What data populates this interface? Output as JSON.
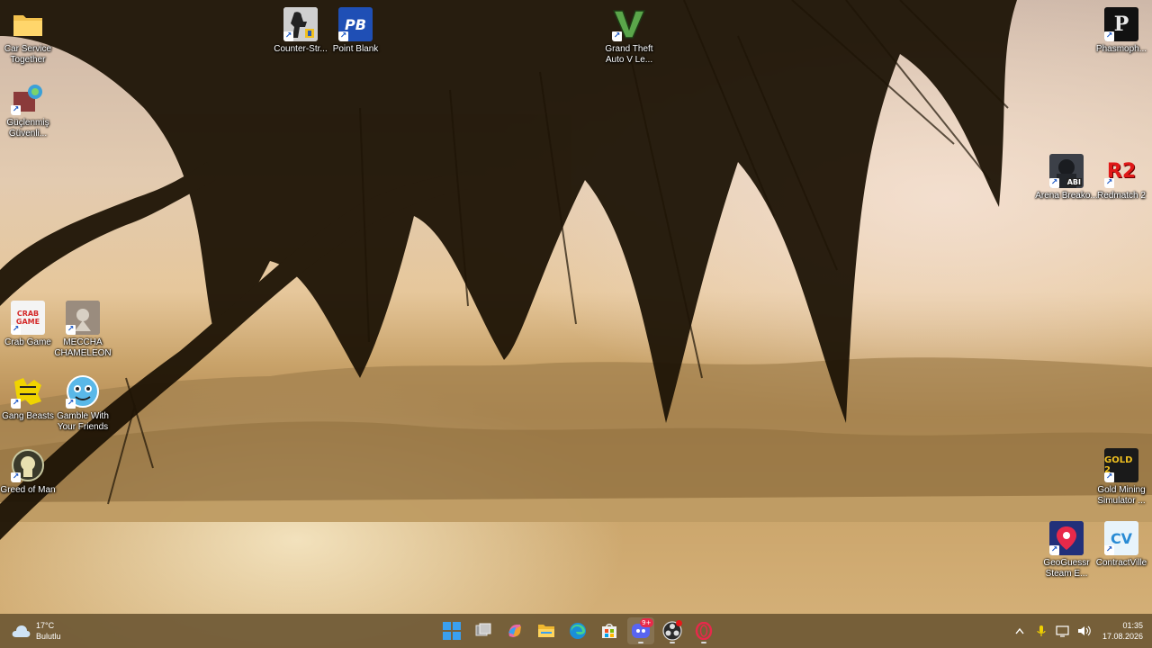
{
  "desktop": {
    "icons": [
      {
        "label": "Car Service Together",
        "icon": "folder-icon"
      },
      {
        "label": "Güçlenmiş Güvenli...",
        "icon": "secure-browser-icon"
      },
      {
        "label": "Counter-Str...",
        "icon": "counter-strike-icon"
      },
      {
        "label": "Point Blank",
        "icon": "point-blank-icon"
      },
      {
        "label": "Grand Theft Auto V Le...",
        "icon": "gta-v-icon"
      },
      {
        "label": "Phasmoph...",
        "icon": "phasmophobia-icon"
      },
      {
        "label": "Arena Breako...",
        "icon": "arena-breakout-icon",
        "badge": "ABI"
      },
      {
        "label": "Redmatch 2",
        "icon": "redmatch-2-icon",
        "badge": "R2"
      },
      {
        "label": "Crab Game",
        "icon": "crab-game-icon",
        "badge": "CRAB GAME"
      },
      {
        "label": "MECCHA CHAMELEON",
        "icon": "meccha-chameleon-icon"
      },
      {
        "label": "Gang Beasts",
        "icon": "gang-beasts-icon"
      },
      {
        "label": "Gamble With Your Friends",
        "icon": "gamble-with-your-friends-icon"
      },
      {
        "label": "Greed of Man",
        "icon": "greed-of-man-icon"
      },
      {
        "label": "Gold Mining Simulator ...",
        "icon": "gold-mining-simulator-icon",
        "badge": "GOLD 2"
      },
      {
        "label": "GeoGuessr Steam E...",
        "icon": "geoguessr-icon"
      },
      {
        "label": "ContractVille",
        "icon": "contractville-icon",
        "badge": "CV"
      }
    ]
  },
  "taskbar": {
    "weather": {
      "temp": "17°C",
      "condition": "Bulutlu"
    },
    "apps": [
      {
        "name": "start-button"
      },
      {
        "name": "task-view"
      },
      {
        "name": "copilot"
      },
      {
        "name": "file-explorer"
      },
      {
        "name": "edge"
      },
      {
        "name": "microsoft-store"
      },
      {
        "name": "discord",
        "badge": "9+"
      },
      {
        "name": "obs"
      },
      {
        "name": "opera-gx"
      }
    ],
    "clock": {
      "time": "01:35",
      "date": "17.08.2026"
    }
  },
  "colors": {
    "taskbar": "#6e5834",
    "accent": "#0078d4"
  }
}
